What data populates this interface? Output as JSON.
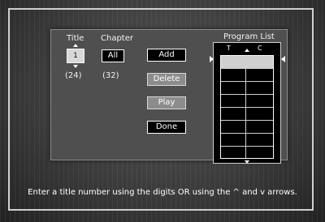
{
  "title_section": {
    "label": "Title",
    "value": "1",
    "count": "(24)"
  },
  "chapter_section": {
    "label": "Chapter",
    "value": "All",
    "count": "(32)"
  },
  "actions": {
    "add": "Add",
    "delete": "Delete",
    "play": "Play",
    "done": "Done"
  },
  "program_list": {
    "title": "Program List",
    "col_t": "T",
    "col_c": "C",
    "rows": [
      {
        "t": "",
        "c": ""
      },
      {
        "t": "",
        "c": ""
      },
      {
        "t": "",
        "c": ""
      },
      {
        "t": "",
        "c": ""
      },
      {
        "t": "",
        "c": ""
      },
      {
        "t": "",
        "c": ""
      },
      {
        "t": "",
        "c": ""
      },
      {
        "t": "",
        "c": ""
      }
    ]
  },
  "hint_text": "Enter a title number using the digits OR using the ^ and v arrows.",
  "colors": {
    "background": "#3b3b3b",
    "panel": "#4f4f4f",
    "selected_highlight": "#d8d8d8",
    "button_dark": "#000000",
    "button_light": "#8c8c8c"
  },
  "icons": [
    "up-arrow-icon",
    "down-arrow-icon",
    "left-arrow-icon",
    "right-arrow-icon"
  ]
}
